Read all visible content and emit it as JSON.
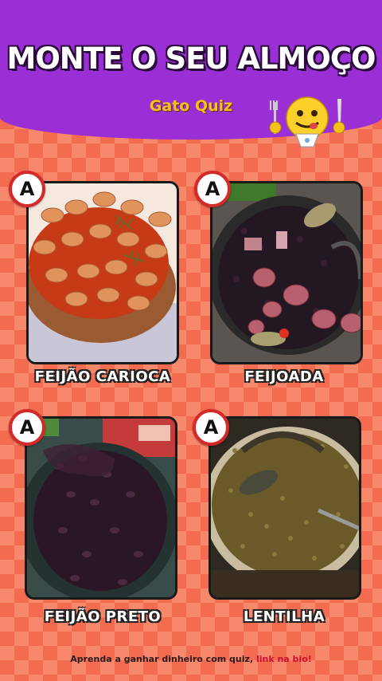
{
  "header": {
    "title": "MONTE O SEU ALMOÇO",
    "brand": "Gato Quiz",
    "mascot_icon": "face-savoring-food-emoji-icon"
  },
  "options": [
    {
      "badge": "A",
      "label": "FEIJÃO CARIOCA",
      "image": "carioca-beans-photo"
    },
    {
      "badge": "A",
      "label": "FEIJOADA",
      "image": "feijoada-pot-photo"
    },
    {
      "badge": "A",
      "label": "FEIJÃO PRETO",
      "image": "black-beans-bowl-photo"
    },
    {
      "badge": "A",
      "label": "LENTILHA",
      "image": "lentils-pot-photo"
    }
  ],
  "footer": {
    "text": "Aprenda a ganhar dinheiro com quiz, ",
    "link": "link na bio!"
  },
  "colors": {
    "header_purple": "#9b2fd6",
    "background_orange": "#f36b50",
    "badge_red": "#d42a2a",
    "brand_yellow": "#f5c21b",
    "link_red": "#c8102e"
  }
}
